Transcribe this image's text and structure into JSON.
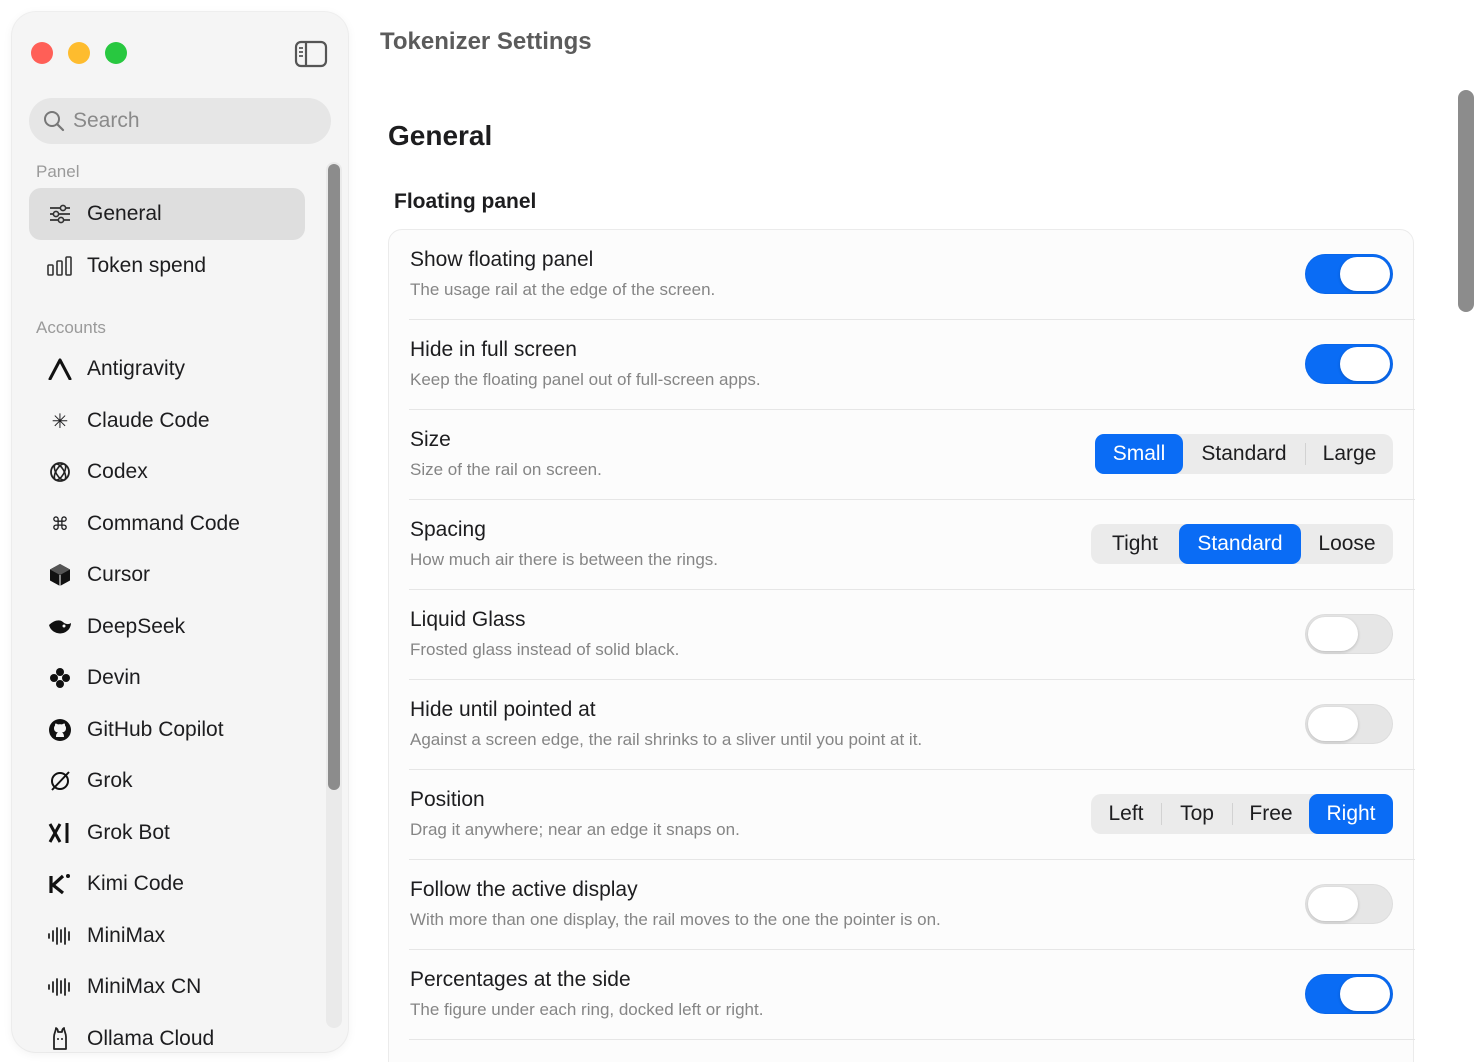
{
  "window": {
    "title": "Tokenizer Settings"
  },
  "sidebar": {
    "search_placeholder": "Search",
    "sections": [
      {
        "label": "Panel"
      },
      {
        "label": "Accounts"
      }
    ],
    "panel_items": [
      {
        "label": "General",
        "icon": "sliders-icon",
        "active": true
      },
      {
        "label": "Token spend",
        "icon": "bar-chart-icon",
        "active": false
      }
    ],
    "account_items": [
      {
        "label": "Antigravity",
        "icon": "antigravity-logo-icon"
      },
      {
        "label": "Claude Code",
        "icon": "claude-starburst-icon"
      },
      {
        "label": "Codex",
        "icon": "openai-knot-icon"
      },
      {
        "label": "Command Code",
        "icon": "command-key-icon"
      },
      {
        "label": "Cursor",
        "icon": "cursor-cube-icon"
      },
      {
        "label": "DeepSeek",
        "icon": "deepseek-whale-icon"
      },
      {
        "label": "Devin",
        "icon": "devin-flower-icon"
      },
      {
        "label": "GitHub Copilot",
        "icon": "github-icon"
      },
      {
        "label": "Grok",
        "icon": "grok-icon"
      },
      {
        "label": "Grok Bot",
        "icon": "xai-icon"
      },
      {
        "label": "Kimi Code",
        "icon": "kimi-icon"
      },
      {
        "label": "MiniMax",
        "icon": "waveform-icon"
      },
      {
        "label": "MiniMax CN",
        "icon": "waveform-icon"
      },
      {
        "label": "Ollama Cloud",
        "icon": "ollama-icon"
      }
    ]
  },
  "main": {
    "heading": "General",
    "group": "Floating panel",
    "rows": [
      {
        "title": "Show floating panel",
        "desc": "The usage rail at the edge of the screen.",
        "control": "toggle",
        "on": true
      },
      {
        "title": "Hide in full screen",
        "desc": "Keep the floating panel out of full-screen apps.",
        "control": "toggle",
        "on": true
      },
      {
        "title": "Size",
        "desc": "Size of the rail on screen.",
        "control": "segmented",
        "options": [
          "Small",
          "Standard",
          "Large"
        ],
        "selected": "Small"
      },
      {
        "title": "Spacing",
        "desc": "How much air there is between the rings.",
        "control": "segmented",
        "options": [
          "Tight",
          "Standard",
          "Loose"
        ],
        "selected": "Standard"
      },
      {
        "title": "Liquid Glass",
        "desc": "Frosted glass instead of solid black.",
        "control": "toggle",
        "on": false
      },
      {
        "title": "Hide until pointed at",
        "desc": "Against a screen edge, the rail shrinks to a sliver until you point at it.",
        "control": "toggle",
        "on": false
      },
      {
        "title": "Position",
        "desc": "Drag it anywhere; near an edge it snaps on.",
        "control": "segmented",
        "options": [
          "Left",
          "Top",
          "Free",
          "Right"
        ],
        "selected": "Right"
      },
      {
        "title": "Follow the active display",
        "desc": "With more than one display, the rail moves to the one the pointer is on.",
        "control": "toggle",
        "on": false
      },
      {
        "title": "Percentages at the side",
        "desc": "The figure under each ring, docked left or right.",
        "control": "toggle",
        "on": true
      }
    ]
  },
  "colors": {
    "accent": "#0a6cf5",
    "sidebar_bg": "#f5f5f5",
    "selected_item": "#dedede"
  }
}
